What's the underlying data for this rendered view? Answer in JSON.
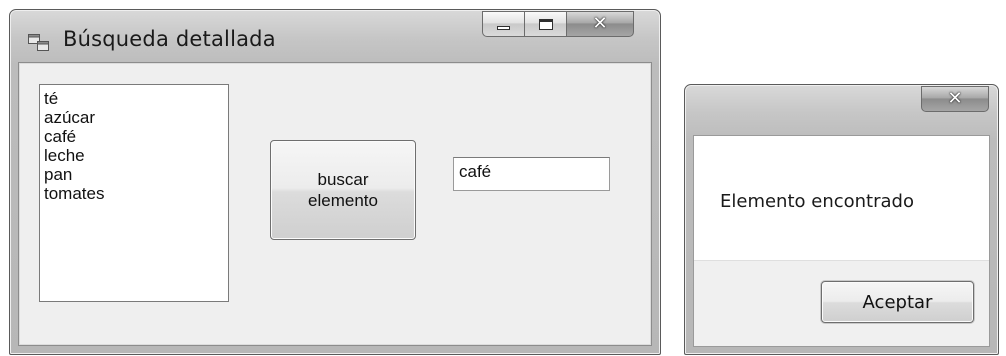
{
  "main_window": {
    "title": "Búsqueda detallada",
    "list_items": [
      "té",
      "azúcar",
      "café",
      "leche",
      "pan",
      "tomates"
    ],
    "search_button_label": "buscar\nelemento",
    "text_field_value": "café"
  },
  "message_box": {
    "message": "Elemento encontrado",
    "ok_label": "Aceptar"
  }
}
